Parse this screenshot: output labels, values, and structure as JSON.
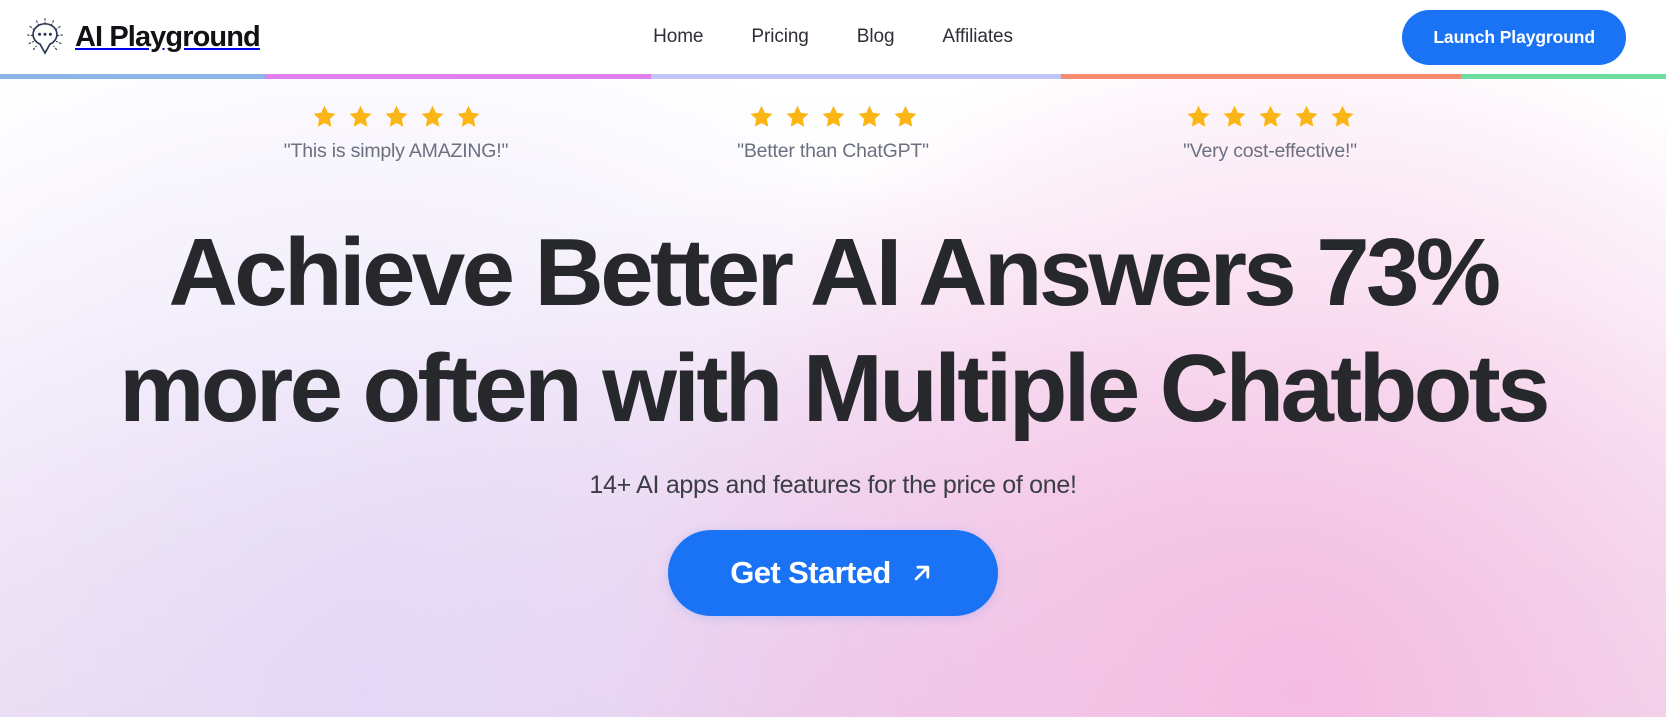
{
  "header": {
    "logo_icon": "chat-bubble-sun-icon",
    "brand_name": "AI Playground",
    "nav": [
      {
        "label": "Home"
      },
      {
        "label": "Pricing"
      },
      {
        "label": "Blog"
      },
      {
        "label": "Affiliates"
      }
    ],
    "cta_label": "Launch Playground",
    "cta_color": "#1a73f5"
  },
  "color_bar": {
    "segments": [
      {
        "color": "#8cb4e8",
        "width_pct": 15.9
      },
      {
        "color": "#e07ff0",
        "width_pct": 23.2
      },
      {
        "color": "#bfc6f5",
        "width_pct": 24.6
      },
      {
        "color": "#f78b6d",
        "width_pct": 24.0
      },
      {
        "color": "#6fdda0",
        "width_pct": 12.3
      }
    ]
  },
  "testimonials": [
    {
      "rating": 5,
      "quote": "\"This is simply AMAZING!\""
    },
    {
      "rating": 5,
      "quote": "\"Better than ChatGPT\""
    },
    {
      "rating": 5,
      "quote": "\"Very cost-effective!\""
    }
  ],
  "star_color": "#fbb615",
  "hero": {
    "headline_line1": "Achieve Better AI Answers 73%",
    "headline_line2": "more often with Multiple Chatbots",
    "subheadline": "14+ AI apps and features for the price of one!",
    "cta_label": "Get Started",
    "cta_icon": "arrow-up-right-icon",
    "cta_color": "#1a73f5"
  }
}
